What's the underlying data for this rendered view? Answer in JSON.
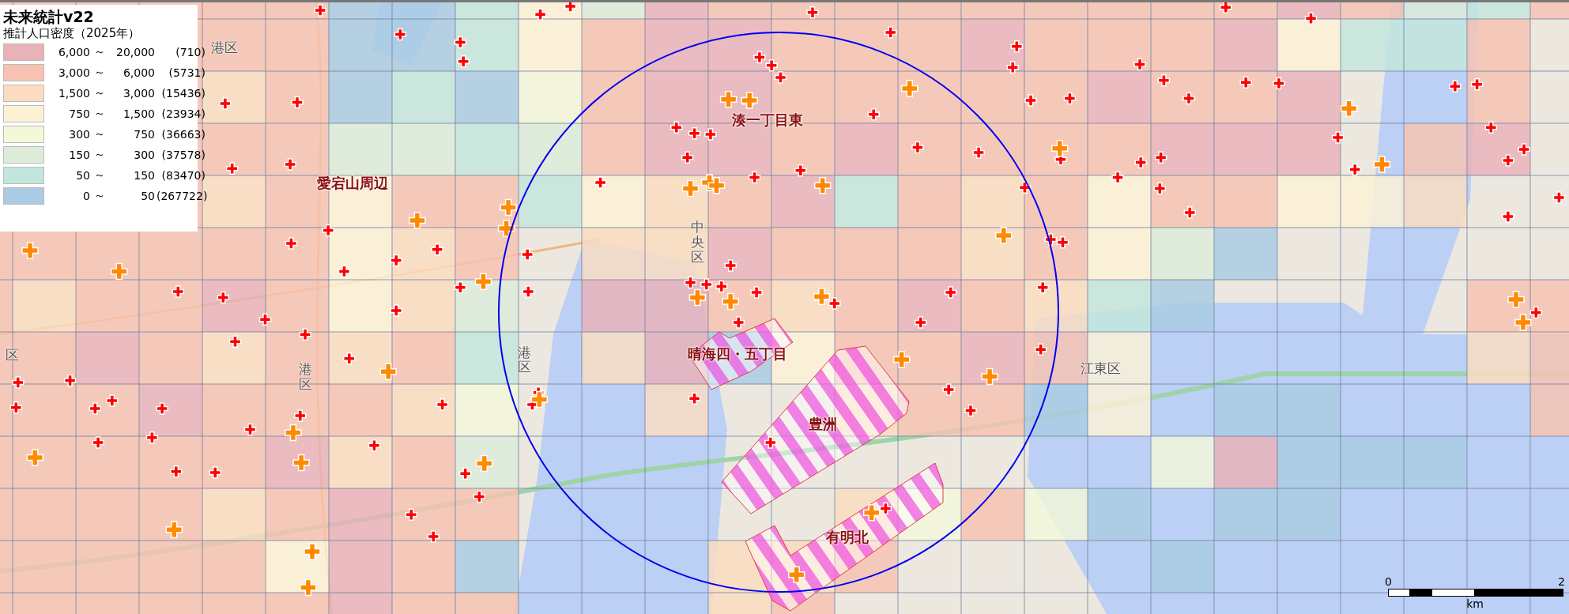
{
  "legend": {
    "title": "未来統計v22",
    "subtitle": "推計人口密度（2025年）",
    "classes": [
      {
        "from": "6,000",
        "sep": "～",
        "to": "20,000",
        "count": "(710)",
        "color": "#e9b1b8"
      },
      {
        "from": "3,000",
        "sep": "～",
        "to": "6,000",
        "count": "(5731)",
        "color": "#f7c2b1"
      },
      {
        "from": "1,500",
        "sep": "～",
        "to": "3,000",
        "count": "(15436)",
        "color": "#fbdcc0"
      },
      {
        "from": "750",
        "sep": "～",
        "to": "1,500",
        "count": "(23934)",
        "color": "#fdf1d5"
      },
      {
        "from": "300",
        "sep": "～",
        "to": "750",
        "count": "(36663)",
        "color": "#f3f8d9"
      },
      {
        "from": "150",
        "sep": "～",
        "to": "300",
        "count": "(37578)",
        "color": "#dcecd9"
      },
      {
        "from": "50",
        "sep": "～",
        "to": "150",
        "count": "(83470)",
        "color": "#c3e6dc"
      },
      {
        "from": "0",
        "sep": "～",
        "to": "50",
        "count": "(267722)",
        "color": "#aacbe3"
      }
    ]
  },
  "map": {
    "area_labels": [
      {
        "text": "愛宕山周辺"
      },
      {
        "text": "湊一丁目東"
      },
      {
        "text": "晴海四・五丁目"
      },
      {
        "text": "豊洲"
      },
      {
        "text": "有明北"
      }
    ],
    "ward_labels": [
      {
        "text": "港区",
        "vertical": false
      },
      {
        "text": "中央区",
        "vertical": true
      },
      {
        "text": "港区",
        "vertical": true
      },
      {
        "text": "港区",
        "vertical": true
      },
      {
        "text": "江東区",
        "vertical": false
      },
      {
        "text": "区",
        "vertical": false
      }
    ]
  },
  "scale_bar": {
    "start": "0",
    "end": "2",
    "unit": "km"
  }
}
